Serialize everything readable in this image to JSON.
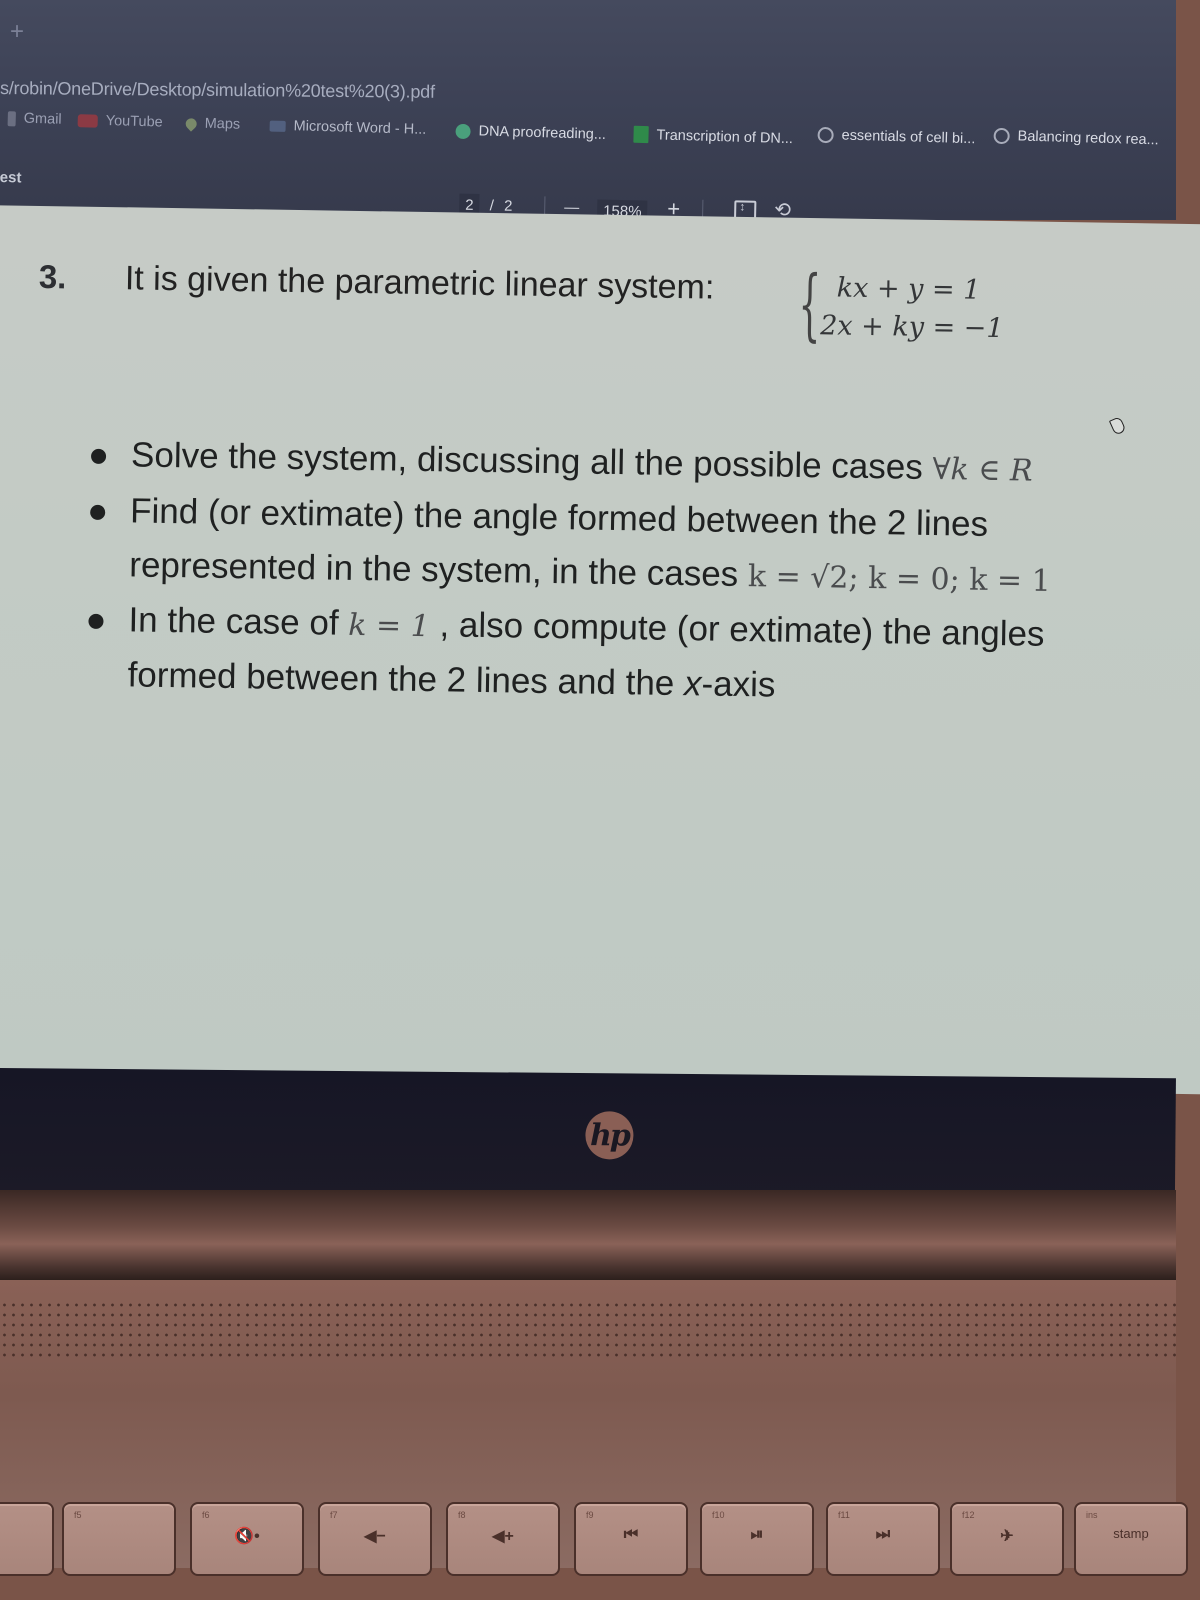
{
  "browser": {
    "new_tab_icon": "+",
    "address_bar": "s/robin/OneDrive/Desktop/simulation%20test%20(3).pdf",
    "bookmarks": [
      {
        "label": "Gmail",
        "icon": "gmail-icon"
      },
      {
        "label": "YouTube",
        "icon": "youtube-icon"
      },
      {
        "label": "Maps",
        "icon": "maps-icon"
      },
      {
        "label": "Microsoft Word - H...",
        "icon": "word-icon"
      },
      {
        "label": "DNA proofreading...",
        "icon": "khan-academy-icon"
      },
      {
        "label": "Transcription of DN...",
        "icon": "transcription-icon"
      },
      {
        "label": "essentials of cell bi...",
        "icon": "globe-icon"
      },
      {
        "label": "Balancing redox rea...",
        "icon": "globe-icon"
      }
    ]
  },
  "pdf_toolbar": {
    "doc_title": "est",
    "current_page": "2",
    "page_separator": "/",
    "total_pages": "2",
    "zoom_out": "—",
    "zoom_level": "158%",
    "zoom_in": "+",
    "fit_icon": "fit-page-icon",
    "rotate_icon": "rotate-icon"
  },
  "document": {
    "question_number": "3.",
    "question_text": "It is given the parametric linear system:",
    "system": {
      "eq1": "kx + y = 1",
      "eq2": "2x + ky = −1"
    },
    "bullets": [
      {
        "lines": [
          {
            "text": "Solve the system, discussing all the possible cases ",
            "math": "∀k ∈ R"
          }
        ]
      },
      {
        "lines": [
          {
            "text": "Find (or extimate) the angle formed between the 2 lines"
          },
          {
            "text": "represented in the system, in the cases ",
            "math": "k = √2; k = 0; k = 1"
          }
        ]
      },
      {
        "lines": [
          {
            "text_before": "In the case of ",
            "math": "k = 1",
            "text_after": " , also compute (or extimate) the angles"
          },
          {
            "text": "formed between the 2 lines and the ",
            "em": "x",
            "text_after": "-axis"
          }
        ]
      }
    ]
  },
  "laptop": {
    "logo": "hp",
    "function_keys": [
      {
        "fn": "",
        "glyph": ""
      },
      {
        "fn": "f5",
        "glyph": ""
      },
      {
        "fn": "f6",
        "glyph": "🔇•"
      },
      {
        "fn": "f7",
        "glyph": "◀−"
      },
      {
        "fn": "f8",
        "glyph": "◀+"
      },
      {
        "fn": "f9",
        "glyph": "⏮"
      },
      {
        "fn": "f10",
        "glyph": "⏯"
      },
      {
        "fn": "f11",
        "glyph": "⏭"
      },
      {
        "fn": "f12",
        "glyph": "✈"
      },
      {
        "fn": "ins",
        "glyph": "stamp"
      }
    ]
  }
}
